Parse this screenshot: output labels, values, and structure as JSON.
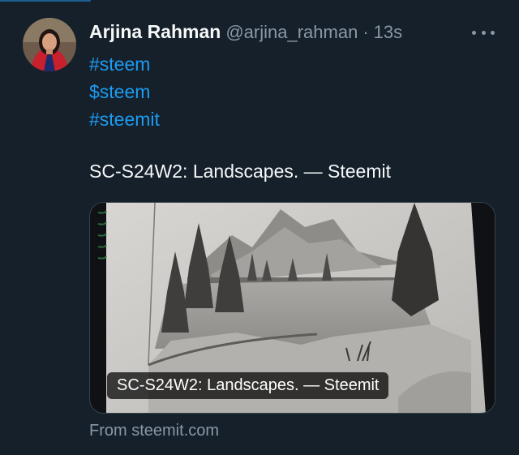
{
  "tweet": {
    "author_name": "Arjina Rahman",
    "author_handle": "@arjina_rahman",
    "separator": "·",
    "timestamp": "13s",
    "hashtags": [
      "#steem",
      "$steem",
      "#steemit"
    ],
    "text": "SC-S24W2: Landscapes. — Steemit"
  },
  "link_card": {
    "caption": "SC-S24W2: Landscapes. — Steemit",
    "source": "From steemit.com",
    "image_subject": "pencil sketch of mountains, lake and pine trees"
  },
  "icons": {
    "more": "more-dots-icon"
  },
  "colors": {
    "background": "#15202b",
    "link": "#1d9bf0",
    "secondary_text": "#8b98a5",
    "primary_text": "#f7f9f9"
  }
}
